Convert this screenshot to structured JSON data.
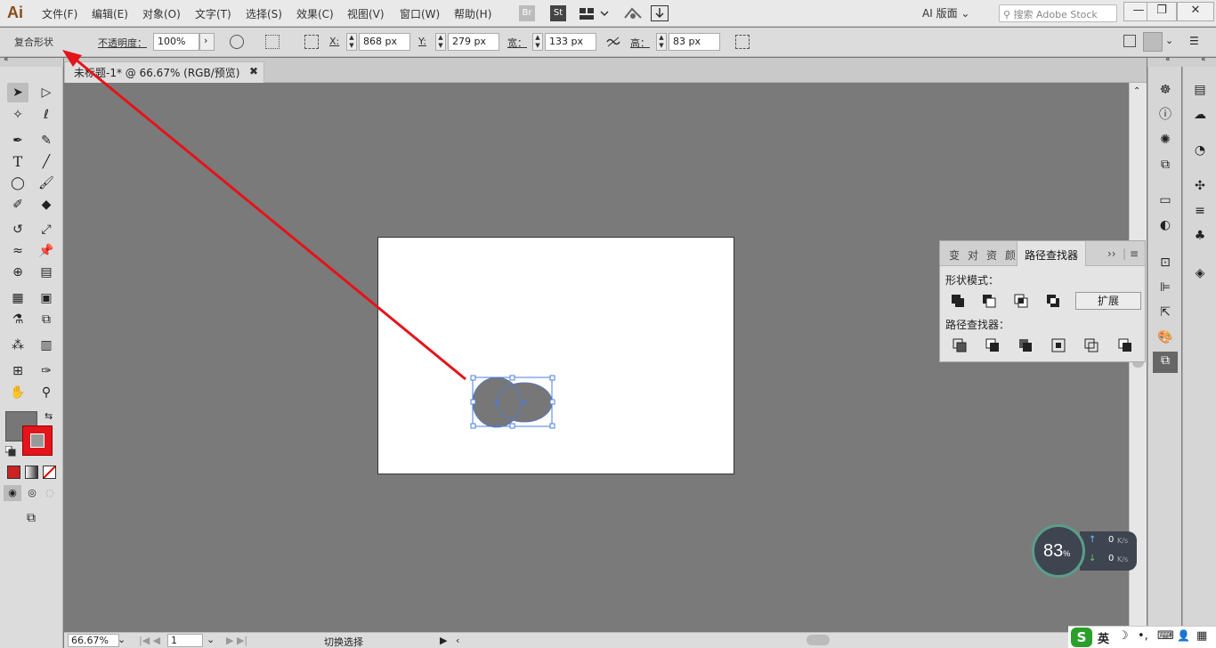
{
  "app": {
    "logo": "Ai"
  },
  "menu": [
    "文件(F)",
    "编辑(E)",
    "对象(O)",
    "文字(T)",
    "选择(S)",
    "效果(C)",
    "视图(V)",
    "窗口(W)",
    "帮助(H)"
  ],
  "topbar": {
    "bridge_label": "Br",
    "stock_label": "St",
    "workspace": "AI 版面",
    "search_placeholder": "搜索 Adobe Stock",
    "min": "—",
    "restore": "❐",
    "close": "✕"
  },
  "control": {
    "compound_shape": "复合形状",
    "opacity_label": "不透明度：",
    "opacity_value": "100%",
    "x_label": "X:",
    "x_value": "868 px",
    "y_label": "Y:",
    "y_value": "279 px",
    "w_label": "宽：",
    "w_value": "133 px",
    "h_label": "高：",
    "h_value": "83 px"
  },
  "document": {
    "tab_title": "未标题-1* @ 66.67% (RGB/预览)",
    "close": "✖"
  },
  "status": {
    "zoom": "66.67%",
    "artboard_num": "1",
    "tool_hint": "切换选择"
  },
  "pathfinder": {
    "tabs": [
      "变",
      "对",
      "资",
      "颜"
    ],
    "active_tab": "路径查找器",
    "shape_modes_label": "形状模式：",
    "expand": "扩展",
    "pathfinders_label": "路径查找器："
  },
  "netmon": {
    "value": "83",
    "unit": "%",
    "up": "0",
    "down": "0",
    "rate_unit": "K/s"
  },
  "ime": {
    "logo": "S",
    "lang": "英",
    "moon": "☽",
    "punct": "•,",
    "kbd": "⌨",
    "user": "👤",
    "grid": "▦"
  },
  "colors": {
    "accent_red": "#e3141b",
    "fill_gray": "#777777",
    "selection_blue": "#4a7cdc"
  }
}
